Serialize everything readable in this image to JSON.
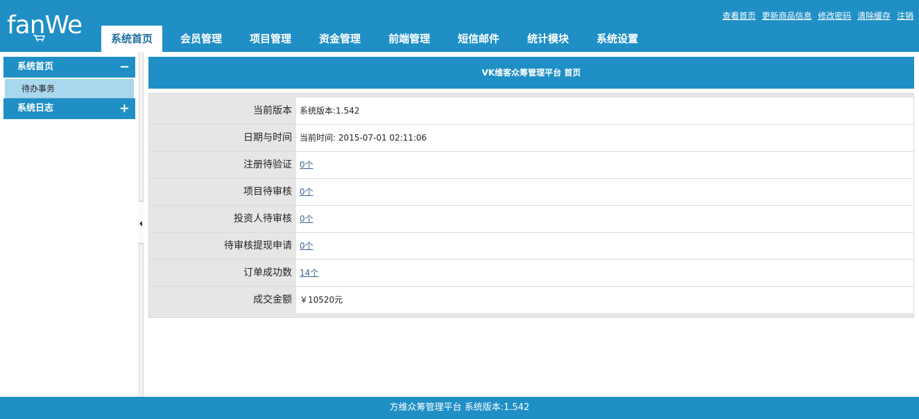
{
  "header": {
    "logo_text": "fanWe",
    "top_links": [
      "查看首页",
      "更新商品信息",
      "修改密码",
      "清除缓存",
      "注销"
    ],
    "tabs": [
      "系统首页",
      "会员管理",
      "项目管理",
      "资金管理",
      "前端管理",
      "短信邮件",
      "统计模块",
      "系统设置"
    ],
    "active_tab": "系统首页"
  },
  "sidebar": {
    "groups": [
      {
        "label": "系统首页",
        "toggle": "−",
        "items": [
          "待办事务"
        ]
      },
      {
        "label": "系统日志",
        "toggle": "+",
        "items": []
      }
    ]
  },
  "main": {
    "title": "VK维客众筹管理平台 首页",
    "rows": [
      {
        "label": "当前版本",
        "value": "系统版本:1.542",
        "link": false
      },
      {
        "label": "日期与时间",
        "value": "当前时间: 2015-07-01 02:11:06",
        "link": false
      },
      {
        "label": "注册待验证",
        "value": "0个",
        "link": true
      },
      {
        "label": "项目待审核",
        "value": "0个",
        "link": true
      },
      {
        "label": "投资人待审核",
        "value": "0个",
        "link": true
      },
      {
        "label": "待审核提现申请",
        "value": "0个",
        "link": true
      },
      {
        "label": "订单成功数",
        "value": "14个",
        "link": true
      },
      {
        "label": "成交金额",
        "value": "￥10520元",
        "link": false
      }
    ]
  },
  "footer": {
    "text": "方维众筹管理平台 系统版本:1.542"
  },
  "colors": {
    "brand_blue": "#1f8fc6",
    "sub_item_bg": "#a9d7ee",
    "link": "#3a5f8a"
  },
  "icons": {
    "collapse": "minus-icon",
    "expand": "plus-icon",
    "splitter": "collapse-arrow-icon",
    "logo_cart": "cart-icon"
  }
}
